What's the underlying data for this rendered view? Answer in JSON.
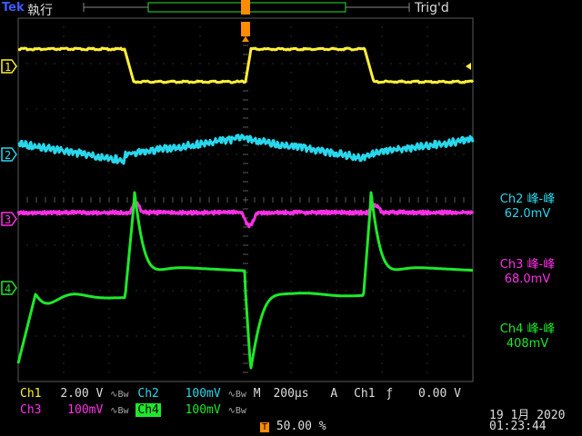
{
  "header": {
    "brand": "Tek",
    "run_state": "執行",
    "trigger_state": "Trig'd"
  },
  "colors": {
    "ch1": "#ffef3a",
    "ch2": "#29d7ec",
    "ch3": "#ff2fe8",
    "ch4": "#1ee82a",
    "grid": "#5a5a5a",
    "trigger": "#ff8c00"
  },
  "channels": [
    {
      "id": "1",
      "name": "Ch1",
      "scale": "2.00 V"
    },
    {
      "id": "2",
      "name": "Ch2",
      "scale": "100mV"
    },
    {
      "id": "3",
      "name": "Ch3",
      "scale": "100mV"
    },
    {
      "id": "4",
      "name": "Ch4",
      "scale": "100mV"
    }
  ],
  "measurements": [
    {
      "label": "Ch2 峰-峰",
      "value": "62.0mV"
    },
    {
      "label": "Ch3 峰-峰",
      "value": "68.0mV"
    },
    {
      "label": "Ch4 峰-峰",
      "value": "408mV"
    }
  ],
  "timebase": {
    "mode": "M",
    "value": "200µs"
  },
  "trigger": {
    "label": "A",
    "source": "Ch1",
    "slope": "ƒ",
    "level": "0.00 V",
    "position": "50.00 %"
  },
  "datetime": {
    "date": "19 1月 2020",
    "time": "01:23:44"
  }
}
